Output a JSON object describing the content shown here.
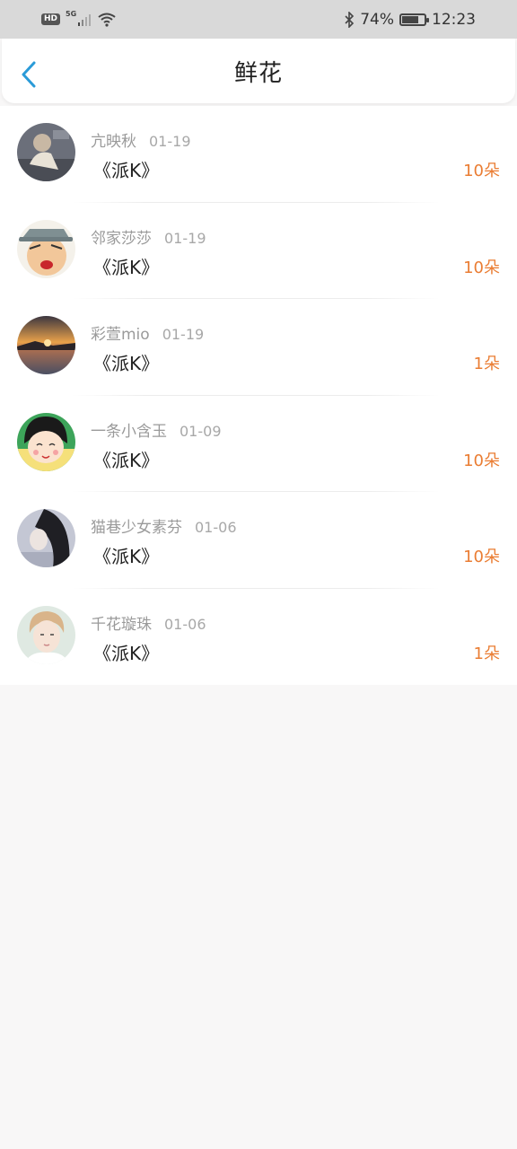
{
  "status_bar": {
    "hd": "HD",
    "network": "5G",
    "battery": "74%",
    "time": "12:23",
    "icons": [
      "signal-icon",
      "wifi-icon",
      "bluetooth-icon",
      "battery-icon"
    ]
  },
  "header": {
    "title": "鲜花",
    "back_icon": "chevron-left-icon",
    "accent": "#2a9bd8"
  },
  "items": [
    {
      "name": "亢映秋",
      "date": "01-19",
      "title": "《派K》",
      "count": "10朵",
      "avatar": "photo-avatar"
    },
    {
      "name": "邻家莎莎",
      "date": "01-19",
      "title": "《派K》",
      "count": "10朵",
      "avatar": "cartoon-avatar"
    },
    {
      "name": "彩萱mio",
      "date": "01-19",
      "title": "《派K》",
      "count": "1朵",
      "avatar": "sunset-avatar"
    },
    {
      "name": "一条小含玉",
      "date": "01-09",
      "title": "《派K》",
      "count": "10朵",
      "avatar": "cartoon-avatar"
    },
    {
      "name": "猫巷少女素芬",
      "date": "01-06",
      "title": "《派K》",
      "count": "10朵",
      "avatar": "photo-avatar"
    },
    {
      "name": "千花璇珠",
      "date": "01-06",
      "title": "《派K》",
      "count": "1朵",
      "avatar": "photo-avatar"
    }
  ],
  "colors": {
    "count": "#ea7d33",
    "name": "#9a9a9a",
    "background": "#f8f7f7"
  }
}
